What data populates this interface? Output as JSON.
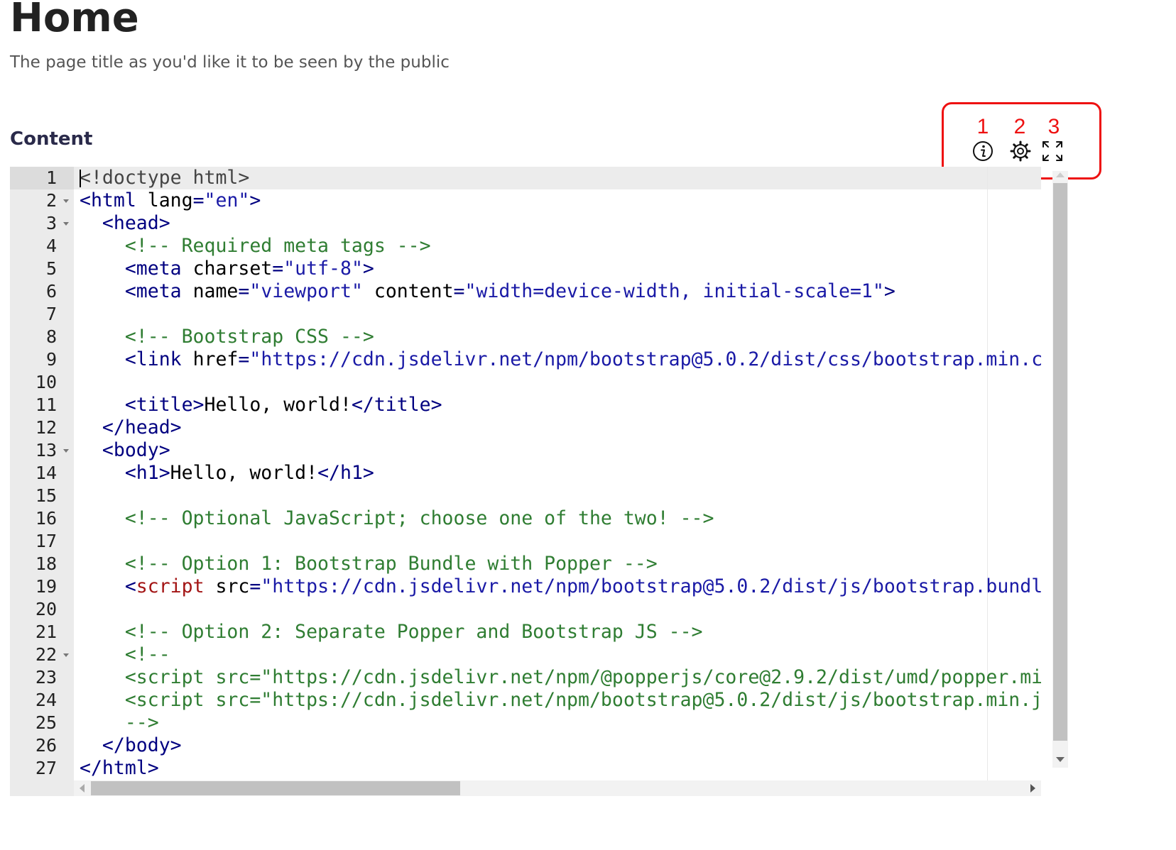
{
  "header": {
    "title": "Home",
    "subtitle": "The page title as you'd like it to be seen by the public"
  },
  "content": {
    "label": "Content"
  },
  "toolbar": {
    "annotations": [
      "1",
      "2",
      "3"
    ],
    "annotation_color": "#ee1111",
    "icons": [
      "info-icon",
      "gear-icon",
      "fullscreen-icon"
    ]
  },
  "editor": {
    "active_line": 1,
    "line_numbers": [
      "1",
      "2",
      "3",
      "4",
      "5",
      "6",
      "7",
      "8",
      "9",
      "10",
      "11",
      "12",
      "13",
      "14",
      "15",
      "16",
      "17",
      "18",
      "19",
      "20",
      "21",
      "22",
      "23",
      "24",
      "25",
      "26",
      "27"
    ],
    "fold_lines": [
      "2",
      "3",
      "13",
      "22"
    ],
    "lines": [
      [
        [
          "doc",
          "<!doctype html>"
        ]
      ],
      [
        [
          "tag",
          "<html"
        ],
        [
          "attr",
          " lang"
        ],
        [
          "tag",
          "="
        ],
        [
          "str",
          "\"en\""
        ],
        [
          "tag",
          ">"
        ]
      ],
      [
        [
          "text",
          "  "
        ],
        [
          "tag",
          "<head>"
        ]
      ],
      [
        [
          "text",
          "    "
        ],
        [
          "com",
          "<!-- Required meta tags -->"
        ]
      ],
      [
        [
          "text",
          "    "
        ],
        [
          "tag",
          "<meta"
        ],
        [
          "attr",
          " charset"
        ],
        [
          "tag",
          "="
        ],
        [
          "str",
          "\"utf-8\""
        ],
        [
          "tag",
          ">"
        ]
      ],
      [
        [
          "text",
          "    "
        ],
        [
          "tag",
          "<meta"
        ],
        [
          "attr",
          " name"
        ],
        [
          "tag",
          "="
        ],
        [
          "str",
          "\"viewport\""
        ],
        [
          "attr",
          " content"
        ],
        [
          "tag",
          "="
        ],
        [
          "str",
          "\"width=device-width, initial-scale=1\""
        ],
        [
          "tag",
          ">"
        ]
      ],
      [],
      [
        [
          "text",
          "    "
        ],
        [
          "com",
          "<!-- Bootstrap CSS -->"
        ]
      ],
      [
        [
          "text",
          "    "
        ],
        [
          "tag",
          "<link"
        ],
        [
          "attr",
          " href"
        ],
        [
          "tag",
          "="
        ],
        [
          "str",
          "\"https://cdn.jsdelivr.net/npm/bootstrap@5.0.2/dist/css/bootstrap.min.c"
        ]
      ],
      [],
      [
        [
          "text",
          "    "
        ],
        [
          "tag",
          "<title>"
        ],
        [
          "text",
          "Hello, world!"
        ],
        [
          "tag",
          "</title>"
        ]
      ],
      [
        [
          "text",
          "  "
        ],
        [
          "tag",
          "</head>"
        ]
      ],
      [
        [
          "text",
          "  "
        ],
        [
          "tag",
          "<body>"
        ]
      ],
      [
        [
          "text",
          "    "
        ],
        [
          "tag",
          "<h1>"
        ],
        [
          "text",
          "Hello, world!"
        ],
        [
          "tag",
          "</h1>"
        ]
      ],
      [],
      [
        [
          "text",
          "    "
        ],
        [
          "com",
          "<!-- Optional JavaScript; choose one of the two! -->"
        ]
      ],
      [],
      [
        [
          "text",
          "    "
        ],
        [
          "com",
          "<!-- Option 1: Bootstrap Bundle with Popper -->"
        ]
      ],
      [
        [
          "text",
          "    "
        ],
        [
          "tag",
          "<"
        ],
        [
          "red",
          "script"
        ],
        [
          "attr",
          " src"
        ],
        [
          "tag",
          "="
        ],
        [
          "str",
          "\"https://cdn.jsdelivr.net/npm/bootstrap@5.0.2/dist/js/bootstrap.bundl"
        ]
      ],
      [],
      [
        [
          "text",
          "    "
        ],
        [
          "com",
          "<!-- Option 2: Separate Popper and Bootstrap JS -->"
        ]
      ],
      [
        [
          "text",
          "    "
        ],
        [
          "com",
          "<!--"
        ]
      ],
      [
        [
          "text",
          "    "
        ],
        [
          "com",
          "<script src=\"https://cdn.jsdelivr.net/npm/@popperjs/core@2.9.2/dist/umd/popper.mi"
        ]
      ],
      [
        [
          "text",
          "    "
        ],
        [
          "com",
          "<script src=\"https://cdn.jsdelivr.net/npm/bootstrap@5.0.2/dist/js/bootstrap.min.j"
        ]
      ],
      [
        [
          "text",
          "    "
        ],
        [
          "com",
          "-->"
        ]
      ],
      [
        [
          "text",
          "  "
        ],
        [
          "tag",
          "</body>"
        ]
      ],
      [
        [
          "tag",
          "</html>"
        ]
      ]
    ]
  }
}
